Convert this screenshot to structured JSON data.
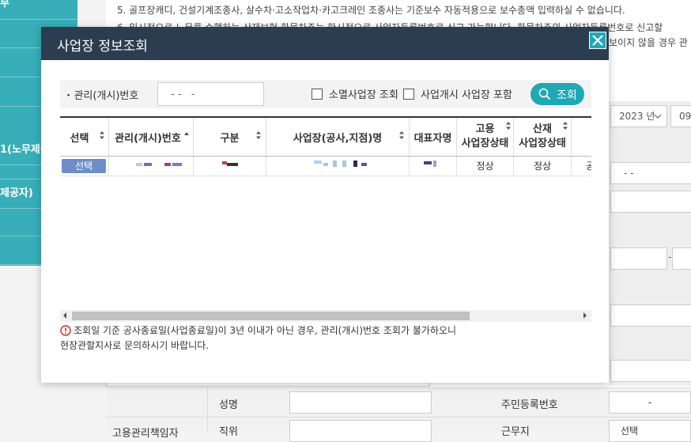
{
  "background": {
    "sidebar_items": [
      {
        "label": "부"
      },
      {
        "label": ""
      },
      {
        "label": ""
      },
      {
        "label": ""
      },
      {
        "label": "1(노무제공"
      },
      {
        "label": "제공자)"
      },
      {
        "label": ""
      },
      {
        "label": ""
      }
    ],
    "notice_lines": [
      "5. 골프장캐디, 건설기계조종사, 살수차·고소작업차·카고크레인 조종사는 기준보수 자동적용으로 보수총액 입력하실 수 없습니다.",
      "6. 일시적으로 노무를 수행하는 산재보험 화물차주는 한시적으로 사업자등록번호로 신고 가능합니다. 화물차주의 사업자등록번호로 신고할"
    ],
    "notice_tail": "보이지 않을 경우 관",
    "year_select": "2023 년",
    "month_select": "09",
    "dash_value": "- -",
    "dash_single": "-",
    "bottom_form": {
      "name_label": "성명",
      "rrn_label": "주민등록번호",
      "rrn_value": "-",
      "section_label": "고용관리책임자",
      "position_label": "직위",
      "dept_label": "근무지",
      "dept_value": "선택"
    }
  },
  "modal": {
    "title": "사업장 정보조회",
    "search": {
      "label": "관리(개시)번호",
      "input_value": "- -   -",
      "closed_business_label": "소멸사업장 조회",
      "started_business_label": "사업개시 사업장 포함",
      "button_label": "조회"
    },
    "table": {
      "headers": [
        {
          "label": "선택"
        },
        {
          "label": "관리(개시)번호"
        },
        {
          "label": "구분"
        },
        {
          "label": "사업장(공사,지점)명"
        },
        {
          "label": "대표자명"
        },
        {
          "label": "고용\n사업장상태"
        },
        {
          "label": "산재\n사업장상태"
        },
        {
          "label": ""
        }
      ],
      "rows": [
        {
          "select_label": "선택",
          "employment_status": "정상",
          "industrial_status": "정상",
          "extra": "공"
        }
      ]
    },
    "notice_lines": [
      "조회일 기준 공사종료일(사업종료일)이 3년 이내가 아닌 경우, 관리(개시)번호 조회가 불가하오니",
      "현장관할지사로 문의하시기 바랍니다."
    ]
  },
  "colors": {
    "header_bg": "#2c3d50",
    "accent": "#20a8b5",
    "select_button": "#6e8ec5",
    "alert": "#d9261c"
  }
}
